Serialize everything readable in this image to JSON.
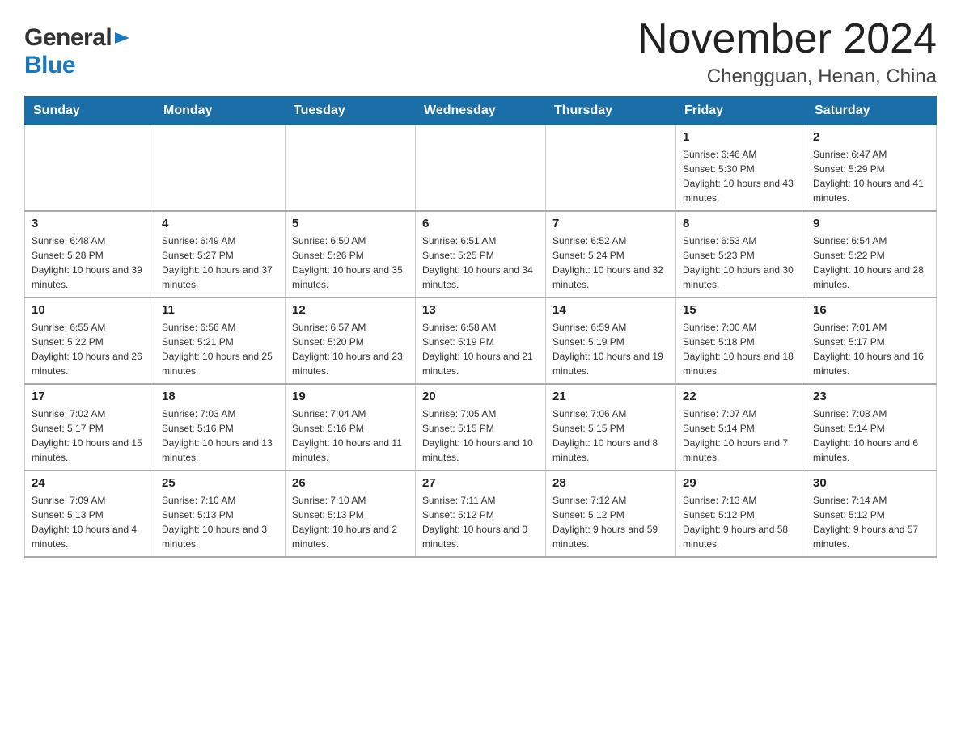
{
  "header": {
    "title": "November 2024",
    "subtitle": "Chengguan, Henan, China",
    "logo_general": "General",
    "logo_blue": "Blue"
  },
  "weekdays": [
    "Sunday",
    "Monday",
    "Tuesday",
    "Wednesday",
    "Thursday",
    "Friday",
    "Saturday"
  ],
  "weeks": [
    [
      {
        "day": "",
        "info": ""
      },
      {
        "day": "",
        "info": ""
      },
      {
        "day": "",
        "info": ""
      },
      {
        "day": "",
        "info": ""
      },
      {
        "day": "",
        "info": ""
      },
      {
        "day": "1",
        "info": "Sunrise: 6:46 AM\nSunset: 5:30 PM\nDaylight: 10 hours and 43 minutes."
      },
      {
        "day": "2",
        "info": "Sunrise: 6:47 AM\nSunset: 5:29 PM\nDaylight: 10 hours and 41 minutes."
      }
    ],
    [
      {
        "day": "3",
        "info": "Sunrise: 6:48 AM\nSunset: 5:28 PM\nDaylight: 10 hours and 39 minutes."
      },
      {
        "day": "4",
        "info": "Sunrise: 6:49 AM\nSunset: 5:27 PM\nDaylight: 10 hours and 37 minutes."
      },
      {
        "day": "5",
        "info": "Sunrise: 6:50 AM\nSunset: 5:26 PM\nDaylight: 10 hours and 35 minutes."
      },
      {
        "day": "6",
        "info": "Sunrise: 6:51 AM\nSunset: 5:25 PM\nDaylight: 10 hours and 34 minutes."
      },
      {
        "day": "7",
        "info": "Sunrise: 6:52 AM\nSunset: 5:24 PM\nDaylight: 10 hours and 32 minutes."
      },
      {
        "day": "8",
        "info": "Sunrise: 6:53 AM\nSunset: 5:23 PM\nDaylight: 10 hours and 30 minutes."
      },
      {
        "day": "9",
        "info": "Sunrise: 6:54 AM\nSunset: 5:22 PM\nDaylight: 10 hours and 28 minutes."
      }
    ],
    [
      {
        "day": "10",
        "info": "Sunrise: 6:55 AM\nSunset: 5:22 PM\nDaylight: 10 hours and 26 minutes."
      },
      {
        "day": "11",
        "info": "Sunrise: 6:56 AM\nSunset: 5:21 PM\nDaylight: 10 hours and 25 minutes."
      },
      {
        "day": "12",
        "info": "Sunrise: 6:57 AM\nSunset: 5:20 PM\nDaylight: 10 hours and 23 minutes."
      },
      {
        "day": "13",
        "info": "Sunrise: 6:58 AM\nSunset: 5:19 PM\nDaylight: 10 hours and 21 minutes."
      },
      {
        "day": "14",
        "info": "Sunrise: 6:59 AM\nSunset: 5:19 PM\nDaylight: 10 hours and 19 minutes."
      },
      {
        "day": "15",
        "info": "Sunrise: 7:00 AM\nSunset: 5:18 PM\nDaylight: 10 hours and 18 minutes."
      },
      {
        "day": "16",
        "info": "Sunrise: 7:01 AM\nSunset: 5:17 PM\nDaylight: 10 hours and 16 minutes."
      }
    ],
    [
      {
        "day": "17",
        "info": "Sunrise: 7:02 AM\nSunset: 5:17 PM\nDaylight: 10 hours and 15 minutes."
      },
      {
        "day": "18",
        "info": "Sunrise: 7:03 AM\nSunset: 5:16 PM\nDaylight: 10 hours and 13 minutes."
      },
      {
        "day": "19",
        "info": "Sunrise: 7:04 AM\nSunset: 5:16 PM\nDaylight: 10 hours and 11 minutes."
      },
      {
        "day": "20",
        "info": "Sunrise: 7:05 AM\nSunset: 5:15 PM\nDaylight: 10 hours and 10 minutes."
      },
      {
        "day": "21",
        "info": "Sunrise: 7:06 AM\nSunset: 5:15 PM\nDaylight: 10 hours and 8 minutes."
      },
      {
        "day": "22",
        "info": "Sunrise: 7:07 AM\nSunset: 5:14 PM\nDaylight: 10 hours and 7 minutes."
      },
      {
        "day": "23",
        "info": "Sunrise: 7:08 AM\nSunset: 5:14 PM\nDaylight: 10 hours and 6 minutes."
      }
    ],
    [
      {
        "day": "24",
        "info": "Sunrise: 7:09 AM\nSunset: 5:13 PM\nDaylight: 10 hours and 4 minutes."
      },
      {
        "day": "25",
        "info": "Sunrise: 7:10 AM\nSunset: 5:13 PM\nDaylight: 10 hours and 3 minutes."
      },
      {
        "day": "26",
        "info": "Sunrise: 7:10 AM\nSunset: 5:13 PM\nDaylight: 10 hours and 2 minutes."
      },
      {
        "day": "27",
        "info": "Sunrise: 7:11 AM\nSunset: 5:12 PM\nDaylight: 10 hours and 0 minutes."
      },
      {
        "day": "28",
        "info": "Sunrise: 7:12 AM\nSunset: 5:12 PM\nDaylight: 9 hours and 59 minutes."
      },
      {
        "day": "29",
        "info": "Sunrise: 7:13 AM\nSunset: 5:12 PM\nDaylight: 9 hours and 58 minutes."
      },
      {
        "day": "30",
        "info": "Sunrise: 7:14 AM\nSunset: 5:12 PM\nDaylight: 9 hours and 57 minutes."
      }
    ]
  ]
}
